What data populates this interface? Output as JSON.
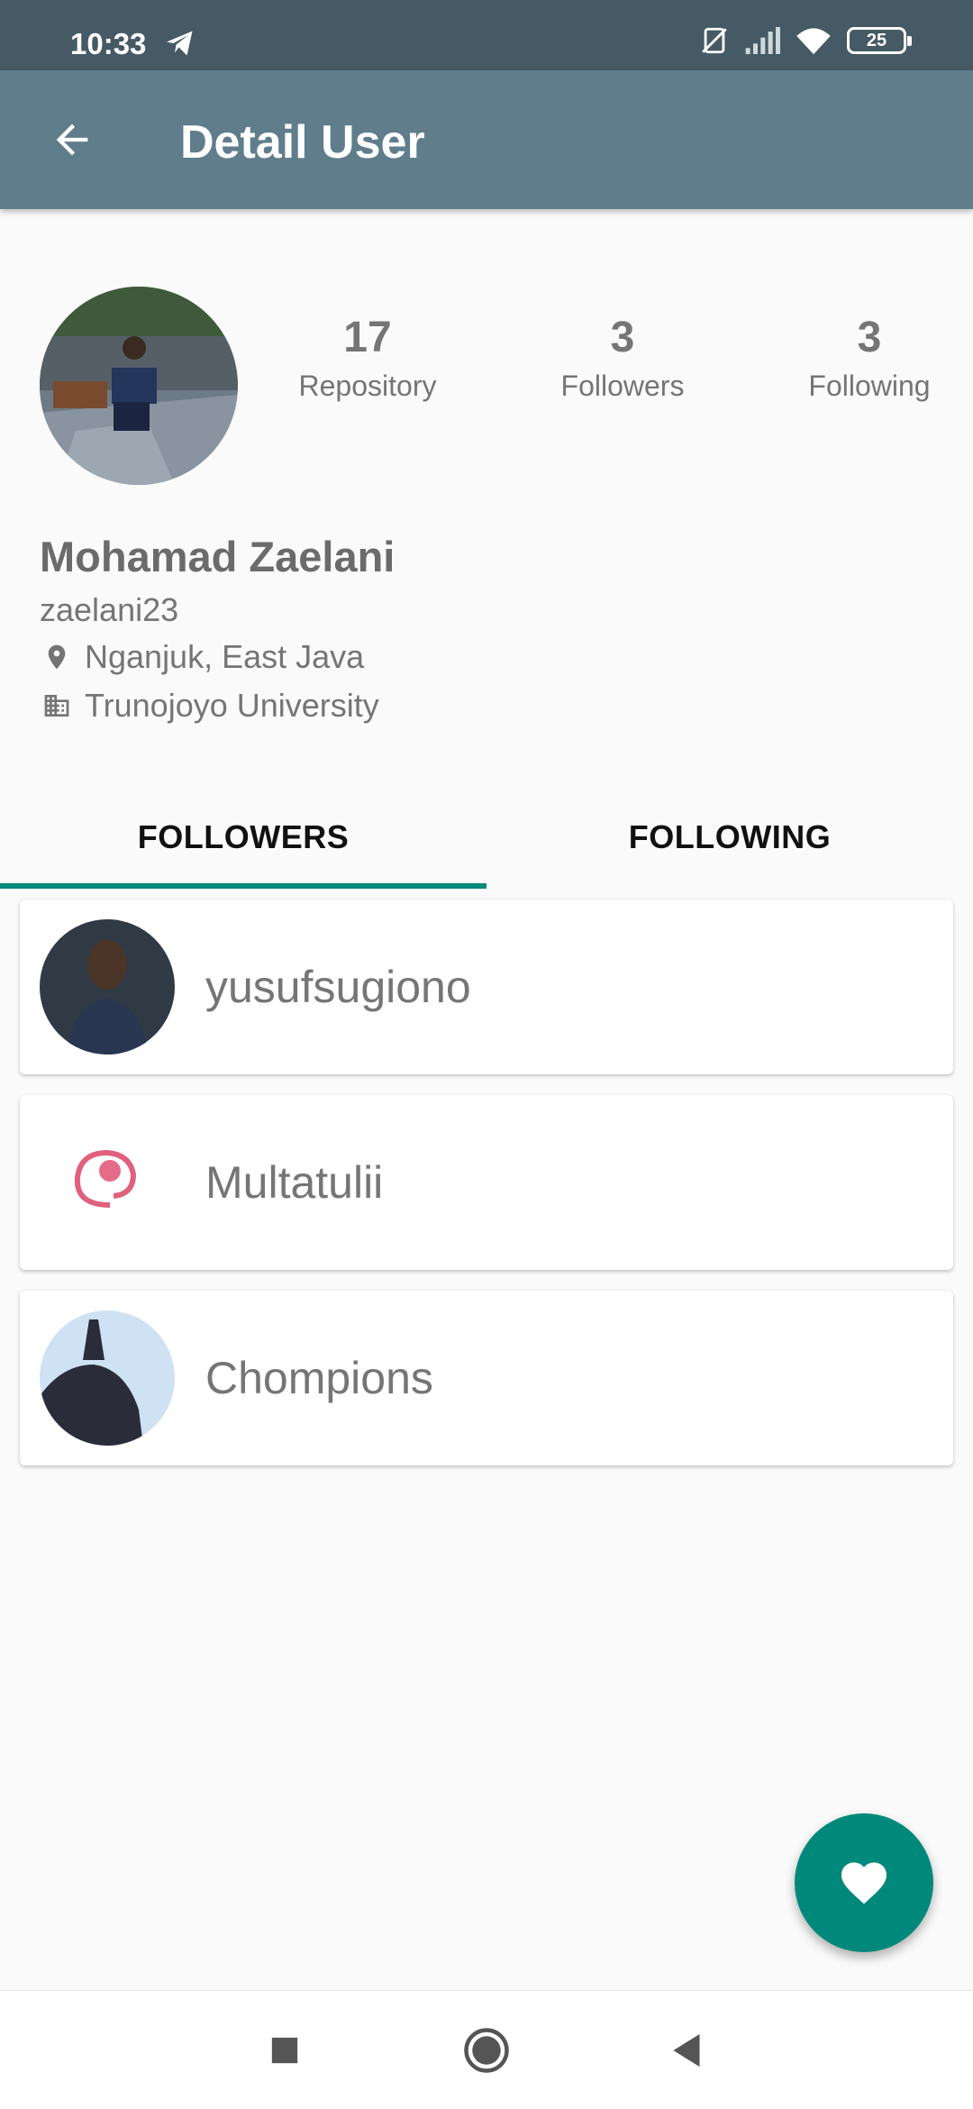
{
  "status_bar": {
    "time": "10:33",
    "battery": "25",
    "icons": [
      "telegram-icon",
      "no-sim-icon",
      "signal-icon",
      "wifi-icon",
      "battery-icon"
    ]
  },
  "app_bar": {
    "title": "Detail User",
    "back_icon": "arrow-back-icon",
    "color": "#607d8b"
  },
  "profile": {
    "name": "Mohamad Zaelani",
    "username": "zaelani23",
    "location": "Nganjuk, East Java",
    "company": "Trunojoyo University",
    "stats": [
      {
        "value": "17",
        "label": "Repository"
      },
      {
        "value": "3",
        "label": "Followers"
      },
      {
        "value": "3",
        "label": "Following"
      }
    ]
  },
  "tabs": {
    "items": [
      "FOLLOWERS",
      "FOLLOWING"
    ],
    "selected": "FOLLOWERS",
    "indicator_color": "#00897b"
  },
  "followers": [
    {
      "login": "yusufsugiono"
    },
    {
      "login": "Multatulii"
    },
    {
      "login": "Chompions"
    }
  ],
  "fab": {
    "icon": "heart-icon",
    "color": "#00897b"
  },
  "nav_bar": {
    "icons": [
      "recents-square-icon",
      "home-circle-icon",
      "back-triangle-icon"
    ]
  }
}
